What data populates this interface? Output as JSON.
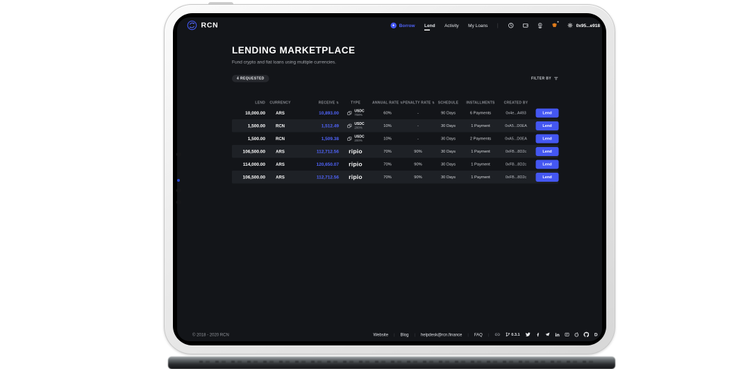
{
  "nav": {
    "brand": "RCN",
    "items": [
      {
        "label": "Borrow"
      },
      {
        "label": "Lend"
      },
      {
        "label": "Activity"
      },
      {
        "label": "My Loans"
      }
    ],
    "icons": [
      "history-clock-icon",
      "wallet-icon",
      "withdraw-icon",
      "metamask-icon",
      "settings-gear-icon"
    ],
    "wallet_address": "0x95...e918"
  },
  "page": {
    "title": "LENDING MARKETPLACE",
    "subtitle": "Fund crypto and fiat loans using multiple currencies.",
    "requested_badge": "4 REQUESTED",
    "filter_label": "FILTER BY"
  },
  "table": {
    "headers": [
      {
        "label": "LEND",
        "sortable": false
      },
      {
        "label": "CURRENCY",
        "sortable": false
      },
      {
        "label": "RECEIVE",
        "sortable": true
      },
      {
        "label": "TYPE",
        "sortable": false
      },
      {
        "label": "ANNUAL RATE",
        "sortable": true
      },
      {
        "label": "PENALTY RATE",
        "sortable": true
      },
      {
        "label": "SCHEDULE",
        "sortable": false
      },
      {
        "label": "INSTALLMENTS",
        "sortable": false
      },
      {
        "label": "CREATED BY",
        "sortable": false
      }
    ],
    "rows": [
      {
        "lend": "10,000.00",
        "currency": "ARS",
        "receive": "10,893.00",
        "type_token": "USDC",
        "type_ratio": "708%",
        "annual_rate": "60%",
        "penalty_rate": "-",
        "schedule": "90 Days",
        "installments": "6 Payments",
        "created_by": "0x4e...A493",
        "action": "Lend"
      },
      {
        "lend": "1,500.00",
        "currency": "RCN",
        "receive": "1,512.49",
        "type_token": "USDC",
        "type_ratio": "200%",
        "annual_rate": "10%",
        "penalty_rate": "-",
        "schedule": "30 Days",
        "installments": "1 Payment",
        "created_by": "0xA5...D0EA",
        "action": "Lend"
      },
      {
        "lend": "1,500.00",
        "currency": "RCN",
        "receive": "1,509.38",
        "type_token": "USDC",
        "type_ratio": "200%",
        "annual_rate": "10%",
        "penalty_rate": "-",
        "schedule": "30 Days",
        "installments": "2 Payments",
        "created_by": "0xA5...D0EA",
        "action": "Lend"
      },
      {
        "lend": "106,500.00",
        "currency": "ARS",
        "receive": "112,712.56",
        "type_brand": "ripio",
        "annual_rate": "70%",
        "penalty_rate": "90%",
        "schedule": "30 Days",
        "installments": "1 Payment",
        "created_by": "0xFB...8D2c",
        "action": "Lend"
      },
      {
        "lend": "114,000.00",
        "currency": "ARS",
        "receive": "120,650.07",
        "type_brand": "ripio",
        "annual_rate": "70%",
        "penalty_rate": "90%",
        "schedule": "30 Days",
        "installments": "1 Payment",
        "created_by": "0xFB...8D2c",
        "action": "Lend"
      },
      {
        "lend": "106,500.00",
        "currency": "ARS",
        "receive": "112,712.56",
        "type_brand": "ripio",
        "annual_rate": "70%",
        "penalty_rate": "90%",
        "schedule": "30 Days",
        "installments": "1 Payment",
        "created_by": "0xFB...8D2c",
        "action": "Lend"
      }
    ]
  },
  "footer": {
    "copyright": "© 2018 - 2020 RCN",
    "links": [
      "Website",
      "Blog",
      "helpdesk@rcn.finance",
      "FAQ"
    ],
    "version": "0.3.1",
    "social_icons": [
      "link-icon",
      "git-branch-icon",
      "twitter-icon",
      "facebook-icon",
      "telegram-icon",
      "linkedin-icon",
      "chat-icon",
      "reddit-icon",
      "github-icon",
      "discourse-icon"
    ]
  },
  "colors": {
    "accent": "#4457F2",
    "receive_text": "#5064FA",
    "app_background": "#131519",
    "row_alt": "#1E2126",
    "muted_text": "#8B8E94",
    "metamask_orange": "#E8821E"
  }
}
